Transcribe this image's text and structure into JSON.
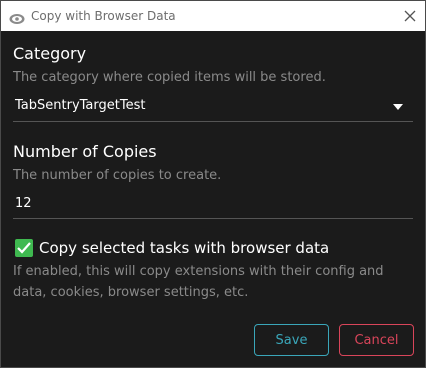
{
  "window": {
    "title": "Copy with Browser Data",
    "icon": "app-logo-icon",
    "close_icon": "close-icon"
  },
  "category": {
    "label": "Category",
    "help": "The category where copied items will be stored.",
    "value": "TabSentryTargetTest",
    "arrow_icon": "dropdown-arrow-icon"
  },
  "copies": {
    "label": "Number of Copies",
    "help": "The number of copies to create.",
    "value": "12"
  },
  "browser_data": {
    "checked": true,
    "label": "Copy selected tasks with browser data",
    "help_line1": "If enabled, this will copy extensions with their config and",
    "help_line2": "data, cookies, browser settings, etc."
  },
  "actions": {
    "save_label": "Save",
    "cancel_label": "Cancel"
  },
  "colors": {
    "background": "#1b1b1b",
    "accent_save": "#3aa6b9",
    "accent_cancel": "#d9455a",
    "checkbox": "#3fb950"
  }
}
